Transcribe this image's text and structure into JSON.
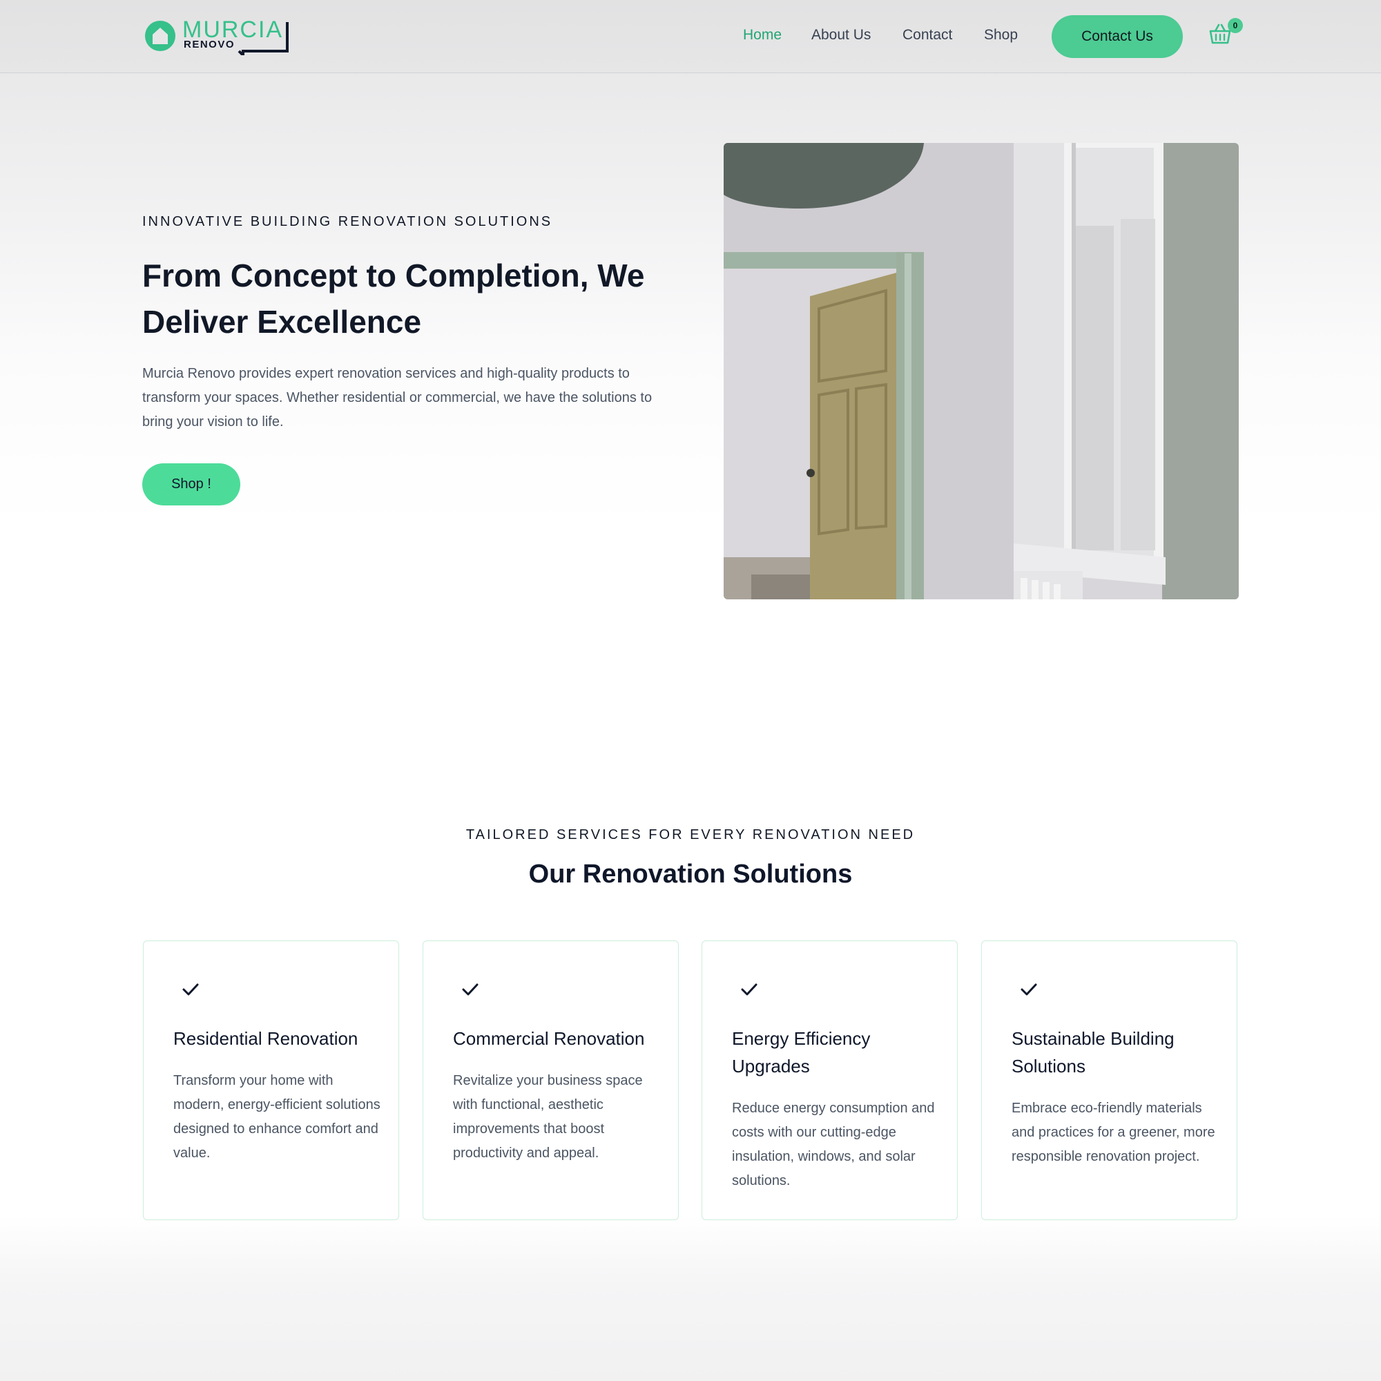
{
  "brand": {
    "name_top": "MURCIA",
    "name_bottom": "RENOVO",
    "colors": {
      "accent": "#4ccb92",
      "accent_text": "#22a673",
      "button_alt": "#4ddb99",
      "dark": "#0f172a"
    }
  },
  "nav": {
    "links": [
      {
        "label": "Home",
        "active": true
      },
      {
        "label": "About Us",
        "active": false
      },
      {
        "label": "Contact",
        "active": false
      },
      {
        "label": "Shop",
        "active": false
      }
    ],
    "cta_label": "Contact Us",
    "cart_icon": "basket-icon",
    "cart_count": "0"
  },
  "hero": {
    "eyebrow": "INNOVATIVE BUILDING RENOVATION SOLUTIONS",
    "title": "From Concept to Completion, We Deliver Excellence",
    "text": "Murcia Renovo provides expert renovation services and high-quality products to transform your spaces. Whether residential or commercial, we have the solutions to bring your vision to life.",
    "button_label": "Shop !"
  },
  "services": {
    "eyebrow": "TAILORED SERVICES FOR EVERY RENOVATION NEED",
    "title": "Our Renovation Solutions",
    "check_icon": "check-icon",
    "cards": [
      {
        "title": "Residential Renovation",
        "text": "Transform your home with modern, energy-efficient solutions designed to enhance comfort and value."
      },
      {
        "title": "Commercial Renovation",
        "text": "Revitalize your business space with functional, aesthetic improvements that boost productivity and appeal."
      },
      {
        "title": "Energy Efficiency Upgrades",
        "text": "Reduce energy consumption and costs with our cutting-edge insulation, windows, and solar solutions."
      },
      {
        "title": "Sustainable Building Solutions",
        "text": "Embrace eco-friendly materials and practices for a greener, more responsible renovation project."
      }
    ]
  }
}
